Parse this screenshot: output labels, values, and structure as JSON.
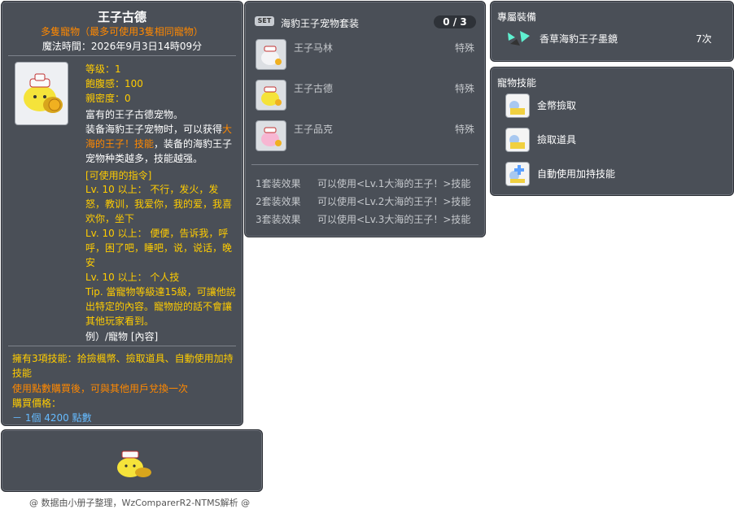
{
  "item_id": "05000461",
  "main": {
    "title": "王子古德",
    "subtitle": "多隻寵物（最多可使用3隻相同寵物）",
    "expiry": "魔法時間：2026年9月3日14時09分",
    "stats": {
      "level": "等级：1",
      "fullness": "飽腹感：100",
      "closeness": "親密度：0"
    },
    "desc1": "富有的王子古德宠物。",
    "desc2_a": "装备海豹王子宠物时，可以获得",
    "desc2_b": "大海的王子！技能",
    "desc2_c": "，装备的海豹王子宠物种类越多，技能越强。",
    "commands_header": "[可使用的指令]",
    "cmd1": "Lv. 10 以上： 不行，发火，发怒，教训，我爱你，我的爱，我喜欢你，坐下",
    "cmd2": "Lv. 10 以上： 便便，告诉我，呼呼，困了吧，睡吧，说，说话，晚安",
    "cmd3": "Lv. 10 以上： 个人技",
    "tip": "Tip. 當寵物等級達15級，可讓他說出特定的內容。寵物說的話不會讓其他玩家看到。",
    "example": "例）/寵物 [內容]",
    "skills_line": "擁有3項技能：拾撿楓幣、撿取道具、自動使用加持技能",
    "exchange_line": "使用點數購買後，可與其他用戶兌換一次",
    "price_label": "購買價格：",
    "price_value": " － 1個 4200 點數"
  },
  "bottom_credit": "@ 数据由小册子整理，WzComparerR2-NTMS解析 @",
  "set": {
    "badge": "SET",
    "title": "海豹王子宠物套装",
    "count": "0 / 3",
    "items": [
      {
        "name": "王子马林",
        "type": "特殊"
      },
      {
        "name": "王子古德",
        "type": "特殊"
      },
      {
        "name": "王子品克",
        "type": "特殊"
      }
    ],
    "effects": [
      {
        "label": "1套装效果",
        "text": "可以使用<Lv.1大海的王子！>技能"
      },
      {
        "label": "2套装效果",
        "text": "可以使用<Lv.2大海的王子！>技能"
      },
      {
        "label": "3套装效果",
        "text": "可以使用<Lv.3大海的王子！>技能"
      }
    ]
  },
  "equip": {
    "header": "專屬裝備",
    "item_name": "香草海豹王子墨鏡",
    "count": "7次"
  },
  "skills": {
    "header": "寵物技能",
    "items": [
      "金幣撿取",
      "撿取道具",
      "自動使用加持技能"
    ]
  }
}
